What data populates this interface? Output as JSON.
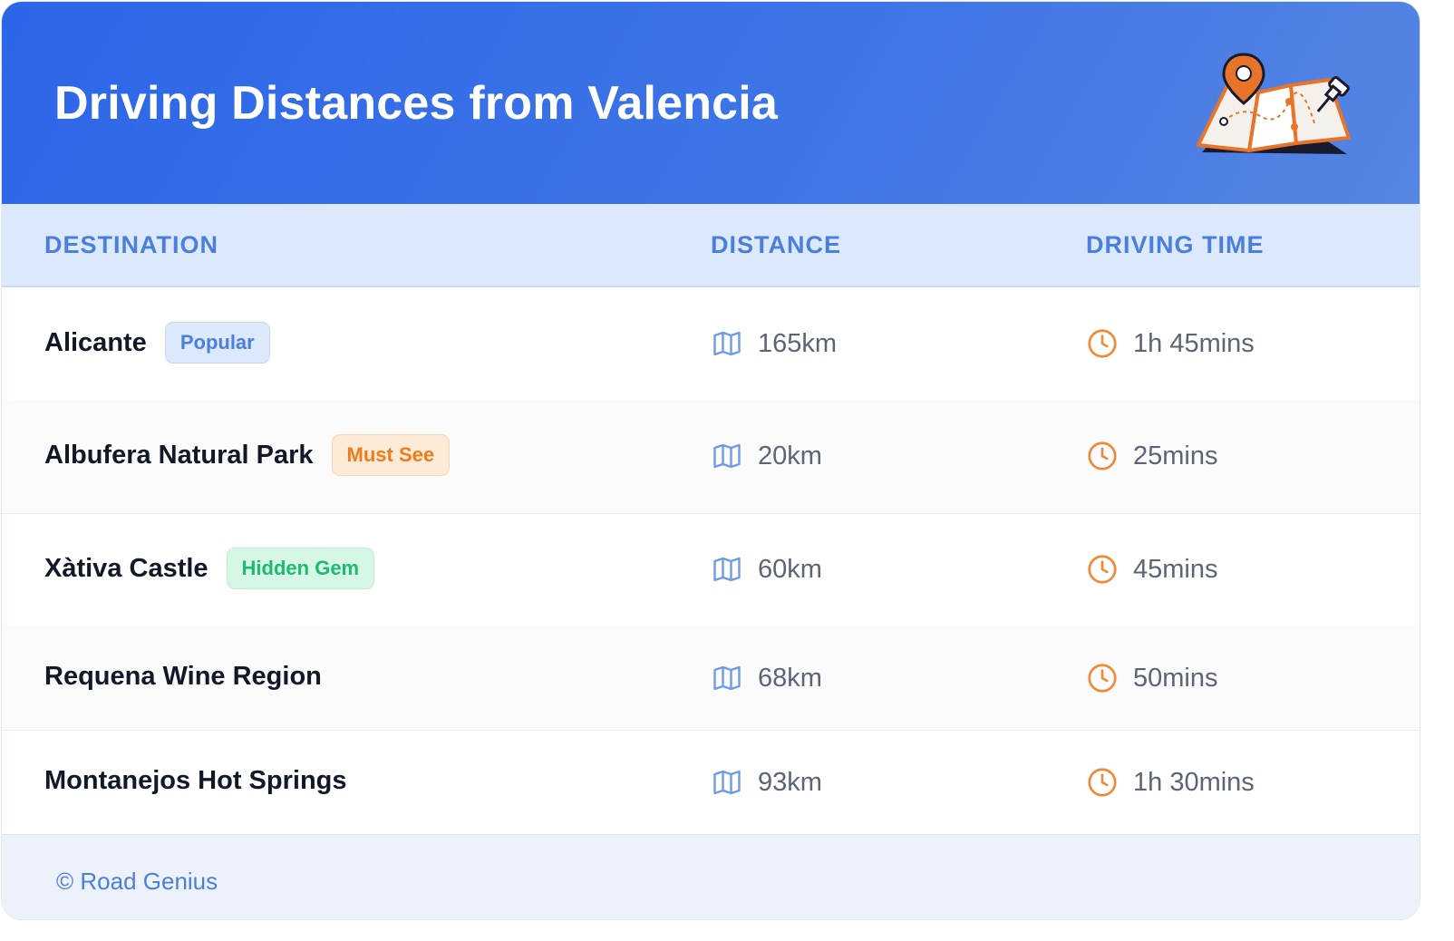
{
  "header": {
    "title": "Driving Distances from Valencia",
    "illustration_icon": "map-with-pins-icon"
  },
  "columns": {
    "destination": "DESTINATION",
    "distance": "DISTANCE",
    "driving_time": "DRIVING TIME"
  },
  "rows": [
    {
      "destination": "Alicante",
      "badge": "Popular",
      "badge_color": "#4a7fdc",
      "distance": "165km",
      "time": "1h 45mins"
    },
    {
      "destination": "Albufera Natural Park",
      "badge": "Must See",
      "badge_color": "#ef7b1a",
      "distance": "20km",
      "time": "25mins"
    },
    {
      "destination": "Xàtiva Castle",
      "badge": "Hidden Gem",
      "badge_color": "#1fb970",
      "distance": "60km",
      "time": "45mins"
    },
    {
      "destination": "Requena Wine Region",
      "badge": "",
      "distance": "68km",
      "time": "50mins"
    },
    {
      "destination": "Montanejos Hot Springs",
      "badge": "",
      "distance": "93km",
      "time": "1h 30mins"
    }
  ],
  "icons": {
    "distance": "map-icon",
    "time": "clock-icon"
  },
  "footer": {
    "credit": "© Road Genius"
  },
  "colors": {
    "header_blue": "#2c66e8",
    "accent_blue": "#4a7fdc",
    "accent_orange": "#ef7b1a",
    "accent_green": "#1fb970"
  }
}
